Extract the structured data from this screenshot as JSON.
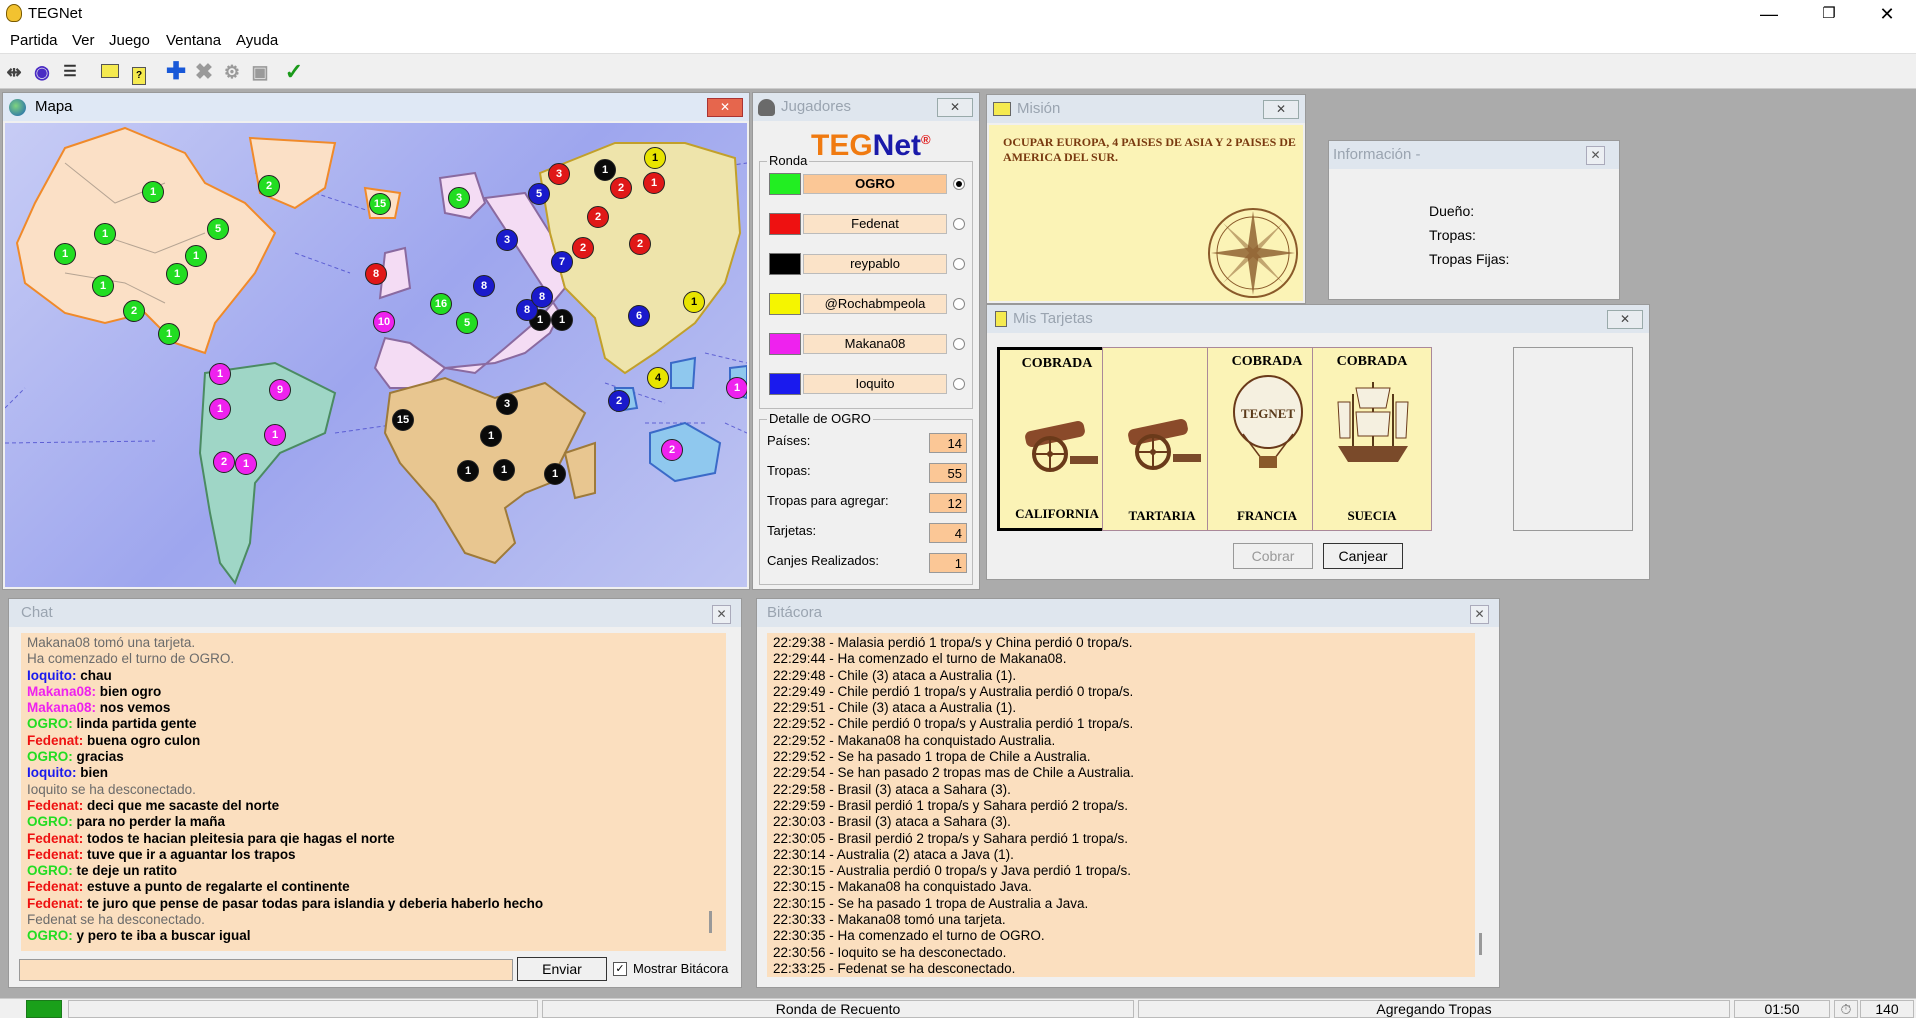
{
  "app": {
    "title": "TEGNet",
    "window_buttons": [
      "—",
      "❐",
      "✕"
    ]
  },
  "menu": [
    "Partida",
    "Ver",
    "Juego",
    "Ventana",
    "Ayuda"
  ],
  "map_window": {
    "title": "Mapa",
    "chips": [
      {
        "n": "1",
        "c": "green"
      },
      {
        "n": "1",
        "c": "green"
      },
      {
        "n": "1",
        "c": "green"
      },
      {
        "n": "5",
        "c": "green"
      },
      {
        "n": "1",
        "c": "green"
      },
      {
        "n": "1",
        "c": "green"
      },
      {
        "n": "2",
        "c": "green"
      },
      {
        "n": "1",
        "c": "green"
      },
      {
        "n": "1",
        "c": "green"
      },
      {
        "n": "2",
        "c": "green"
      },
      {
        "n": "15",
        "c": "green"
      },
      {
        "n": "3",
        "c": "green"
      },
      {
        "n": "16",
        "c": "green"
      },
      {
        "n": "5",
        "c": "green"
      },
      {
        "n": "8",
        "c": "red"
      },
      {
        "n": "3",
        "c": "red"
      },
      {
        "n": "2",
        "c": "red"
      },
      {
        "n": "2",
        "c": "red"
      },
      {
        "n": "2",
        "c": "red"
      },
      {
        "n": "1",
        "c": "red"
      },
      {
        "n": "2",
        "c": "red"
      },
      {
        "n": "1",
        "c": "black"
      },
      {
        "n": "1",
        "c": "black"
      },
      {
        "n": "1",
        "c": "black"
      },
      {
        "n": "3",
        "c": "black"
      },
      {
        "n": "15",
        "c": "black"
      },
      {
        "n": "1",
        "c": "black"
      },
      {
        "n": "1",
        "c": "black"
      },
      {
        "n": "1",
        "c": "black"
      },
      {
        "n": "1",
        "c": "black"
      },
      {
        "n": "1",
        "c": "yellow"
      },
      {
        "n": "1",
        "c": "yellow"
      },
      {
        "n": "4",
        "c": "yellow"
      },
      {
        "n": "10",
        "c": "magenta"
      },
      {
        "n": "1",
        "c": "magenta"
      },
      {
        "n": "9",
        "c": "magenta"
      },
      {
        "n": "1",
        "c": "magenta"
      },
      {
        "n": "1",
        "c": "magenta"
      },
      {
        "n": "2",
        "c": "magenta"
      },
      {
        "n": "1",
        "c": "magenta"
      },
      {
        "n": "2",
        "c": "magenta"
      },
      {
        "n": "1",
        "c": "magenta"
      },
      {
        "n": "5",
        "c": "blue"
      },
      {
        "n": "3",
        "c": "blue"
      },
      {
        "n": "7",
        "c": "blue"
      },
      {
        "n": "8",
        "c": "blue"
      },
      {
        "n": "8",
        "c": "blue"
      },
      {
        "n": "8",
        "c": "blue"
      },
      {
        "n": "6",
        "c": "blue"
      },
      {
        "n": "2",
        "c": "blue"
      }
    ]
  },
  "jugadores": {
    "title": "Jugadores",
    "logo_a": "TEG",
    "logo_b": "Net",
    "logo_reg": "®",
    "ronda_label": "Ronda",
    "players": [
      {
        "name": "OGRO",
        "color": "#22ee22",
        "selected": true
      },
      {
        "name": "Fedenat",
        "color": "#ee1111",
        "selected": false
      },
      {
        "name": "reypablo",
        "color": "#000000",
        "selected": false
      },
      {
        "name": "@Rochabmpeola",
        "color": "#f5f500",
        "selected": false
      },
      {
        "name": "Makana08",
        "color": "#ee22ee",
        "selected": false
      },
      {
        "name": "Ioquito",
        "color": "#1a1aee",
        "selected": false
      }
    ],
    "detalle_label": "Detalle de OGRO",
    "detalle": [
      {
        "label": "Países:",
        "value": "14"
      },
      {
        "label": "Tropas:",
        "value": "55"
      },
      {
        "label": "Tropas para agregar:",
        "value": "12"
      },
      {
        "label": "Tarjetas:",
        "value": "4"
      },
      {
        "label": "Canjes Realizados:",
        "value": "1"
      }
    ]
  },
  "mision": {
    "title": "Misión",
    "text": "OCUPAR EUROPA, 4 PAISES DE ASIA Y 2 PAISES DE AMERICA DEL SUR."
  },
  "info": {
    "title": "Información -",
    "fields": [
      "Dueño:",
      "Tropas:",
      "Tropas Fijas:"
    ]
  },
  "tarjetas": {
    "title": "Mis Tarjetas",
    "cards": [
      {
        "top": "COBRADA",
        "name": "CALIFORNIA",
        "symbol": "cannon",
        "selected": true
      },
      {
        "top": "",
        "name": "TARTARIA",
        "symbol": "cannon",
        "selected": false
      },
      {
        "top": "COBRADA",
        "name": "FRANCIA",
        "symbol": "balloon",
        "selected": false
      },
      {
        "top": "COBRADA",
        "name": "SUECIA",
        "symbol": "ship",
        "selected": false
      }
    ],
    "balloon_text": "TEGNET",
    "cobrar": "Cobrar",
    "canjear": "Canjear"
  },
  "chat": {
    "title": "Chat",
    "lines": [
      {
        "who": "",
        "msg": "Makana08 tomó una tarjeta.",
        "color": "#6b6b6b"
      },
      {
        "who": "",
        "msg": "Ha comenzado el turno de OGRO.",
        "color": "#6b6b6b"
      },
      {
        "who": "Ioquito:",
        "msg": "chau",
        "color": "#1a1aee"
      },
      {
        "who": "Makana08:",
        "msg": "bien ogro",
        "color": "#ee22ee"
      },
      {
        "who": "Makana08:",
        "msg": "nos vemos",
        "color": "#ee22ee"
      },
      {
        "who": "OGRO:",
        "msg": "linda partida gente",
        "color": "#22dd22"
      },
      {
        "who": "Fedenat:",
        "msg": "buena ogro culon",
        "color": "#ee1111"
      },
      {
        "who": "OGRO:",
        "msg": "gracias",
        "color": "#22dd22"
      },
      {
        "who": "Ioquito:",
        "msg": "bien",
        "color": "#1a1aee"
      },
      {
        "who": "",
        "msg": "Ioquito se ha desconectado.",
        "color": "#6b6b6b"
      },
      {
        "who": "Fedenat:",
        "msg": "deci que me sacaste del norte",
        "color": "#ee1111"
      },
      {
        "who": "OGRO:",
        "msg": "para no perder la maña",
        "color": "#22dd22"
      },
      {
        "who": "Fedenat:",
        "msg": "todos te hacian pleitesia para qie hagas el norte",
        "color": "#ee1111"
      },
      {
        "who": "Fedenat:",
        "msg": "tuve que ir a aguantar los trapos",
        "color": "#ee1111"
      },
      {
        "who": "OGRO:",
        "msg": "te deje un ratito",
        "color": "#22dd22"
      },
      {
        "who": "Fedenat:",
        "msg": "estuve a punto de regalarte el continente",
        "color": "#ee1111"
      },
      {
        "who": "Fedenat:",
        "msg": "te juro que pense de pasar todas para islandia y deberia haberlo hecho",
        "color": "#ee1111"
      },
      {
        "who": "",
        "msg": "Fedenat se ha desconectado.",
        "color": "#6b6b6b"
      },
      {
        "who": "OGRO:",
        "msg": "y pero te iba a buscar igual",
        "color": "#22dd22"
      }
    ],
    "input_value": "",
    "send": "Enviar",
    "show_log": "Mostrar Bitácora"
  },
  "bitacora": {
    "title": "Bitácora",
    "lines": [
      "22:29:38 - Malasia perdió 1 tropa/s y China perdió 0 tropa/s.",
      "22:29:44 - Ha comenzado el turno de Makana08.",
      "22:29:48 - Chile (3) ataca a Australia (1).",
      "22:29:49 - Chile perdió 1 tropa/s y Australia perdió 0 tropa/s.",
      "22:29:51 - Chile (3) ataca a Australia (1).",
      "22:29:52 - Chile perdió 0 tropa/s y Australia perdió 1 tropa/s.",
      "22:29:52 - Makana08 ha conquistado Australia.",
      "22:29:52 - Se ha pasado 1 tropa de Chile a Australia.",
      "22:29:54 - Se han pasado 2 tropas mas de Chile a Australia.",
      "22:29:58 - Brasil (3) ataca a Sahara (3).",
      "22:29:59 - Brasil perdió 1 tropa/s y Sahara perdió 2 tropa/s.",
      "22:30:03 - Brasil (3) ataca a Sahara (3).",
      "22:30:05 - Brasil perdió 2 tropa/s y Sahara perdió 1 tropa/s.",
      "22:30:14 - Australia (2) ataca a Java (1).",
      "22:30:15 - Australia perdió 0 tropa/s y Java perdió 1 tropa/s.",
      "22:30:15 - Makana08 ha conquistado Java.",
      "22:30:15 - Se ha pasado 1 tropa de Australia a Java.",
      "22:30:33 - Makana08 tomó una tarjeta.",
      "22:30:35 - Ha comenzado el turno de OGRO.",
      "22:30:56 - Ioquito se ha desconectado.",
      "22:33:25 - Fedenat se ha desconectado."
    ]
  },
  "status": {
    "ronda": "Ronda de Recuento",
    "fase": "Agregando Tropas",
    "timer": "01:50",
    "count": "140"
  },
  "colors": {
    "green": "#22dd22",
    "red": "#e01818",
    "black": "#0a0a0a",
    "yellow": "#e8e400",
    "magenta": "#ee22ee",
    "blue": "#1a1acc",
    "land_peach": "#fbe0c6",
    "land_teal": "#9fd6c6",
    "land_tan": "#e8c690",
    "land_lilac": "#f4dcf4",
    "land_olive": "#eee4ab",
    "land_ice": "#8fc8ee"
  }
}
